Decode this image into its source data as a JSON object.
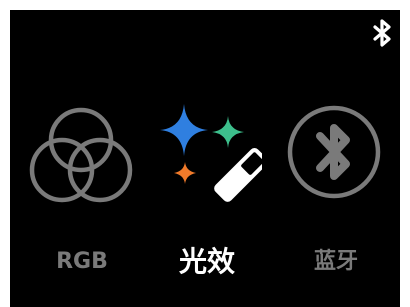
{
  "status_bar": {
    "icon": "bluetooth-icon",
    "icon_color": "#ffffff"
  },
  "modes": {
    "rgb": {
      "label": "RGB",
      "icon": "rgb-circles-icon",
      "selected": false
    },
    "effects": {
      "label": "光效",
      "icon": "sparkle-wand-icon",
      "selected": true
    },
    "bluetooth": {
      "label": "蓝牙",
      "icon": "bluetooth-circle-icon",
      "selected": false
    }
  },
  "colors": {
    "background": "#000000",
    "inactive": "#7a7a7a",
    "active_label": "#ffffff",
    "sparkle_blue": "#2f7fe0",
    "sparkle_green": "#3dbf8c",
    "sparkle_orange": "#f07a2a"
  }
}
